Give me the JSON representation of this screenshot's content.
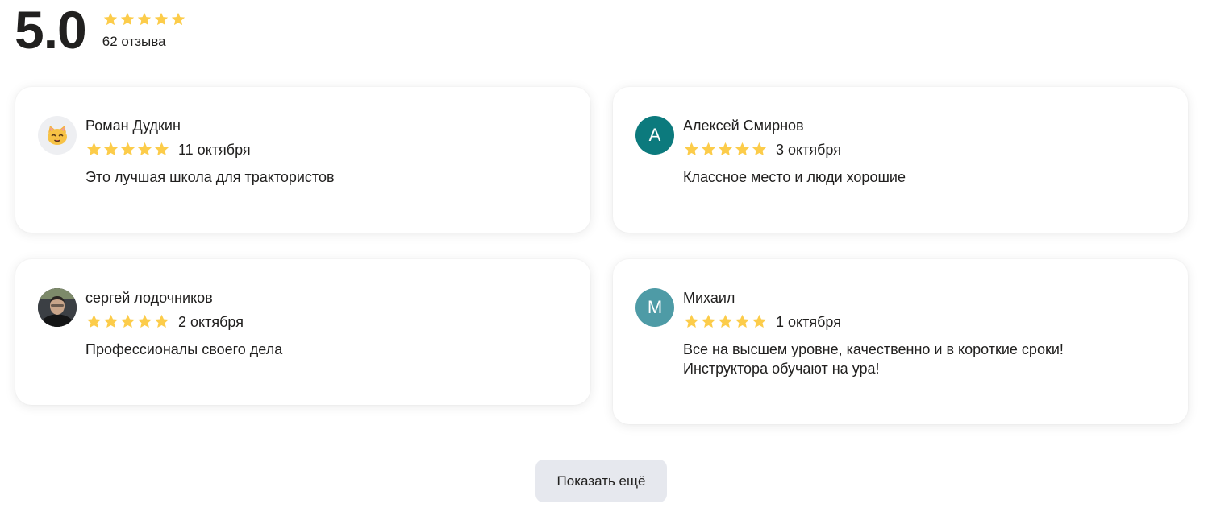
{
  "summary": {
    "rating": "5.0",
    "stars": 5,
    "review_count": "62 отзыва"
  },
  "colors": {
    "star": "#fccc4a",
    "text": "#21201f",
    "button_bg": "#e6e8ee"
  },
  "reviews": [
    {
      "author": "Роман Дудкин",
      "avatar": {
        "type": "emoji",
        "icon": "cat-face-icon",
        "glyph": "🐱"
      },
      "stars": 5,
      "date": "11 октября",
      "text": "Это лучшая школа для трактористов"
    },
    {
      "author": "Алексей Смирнов",
      "avatar": {
        "type": "initial",
        "letter": "А",
        "color": "#0c7a7d"
      },
      "stars": 5,
      "date": "3 октября",
      "text": "Классное место и люди хорошие"
    },
    {
      "author": "сергей лодочников",
      "avatar": {
        "type": "photo",
        "icon": "user-photo-icon"
      },
      "stars": 5,
      "date": "2 октября",
      "text": "Профессионалы своего дела"
    },
    {
      "author": "Михаил",
      "avatar": {
        "type": "initial",
        "letter": "М",
        "color": "#4e9ba6"
      },
      "stars": 5,
      "date": "1 октября",
      "text_line1": "Все на высшем уровне, качественно и в короткие сроки!",
      "text_line2": "Инструктора обучают на ура!"
    }
  ],
  "show_more_label": "Показать ещё"
}
